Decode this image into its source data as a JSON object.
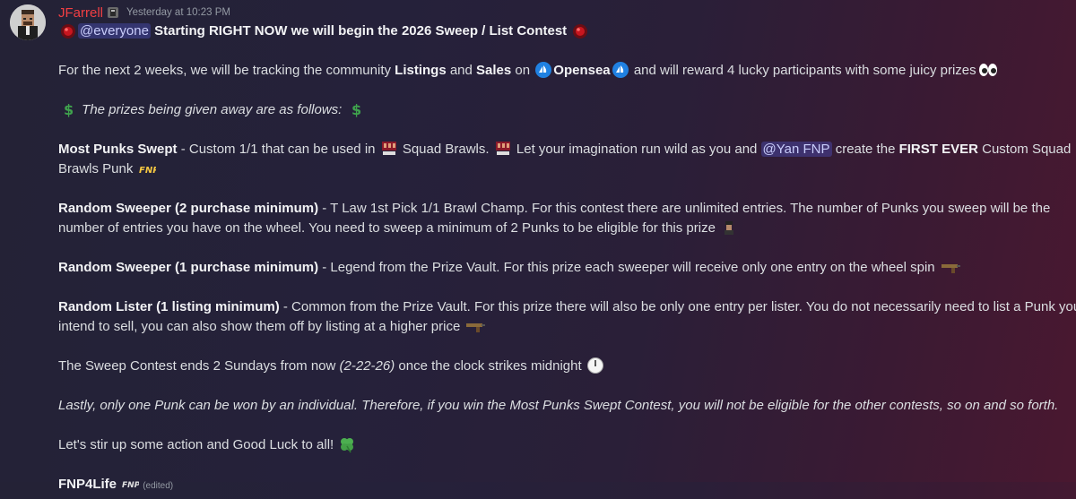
{
  "author": {
    "name": "JFarrell",
    "timestamp": "Yesterday at 10:23 PM"
  },
  "message": {
    "l1": {
      "mention": "@everyone",
      "text": "Starting RIGHT NOW we will begin the 2026 Sweep / List Contest"
    },
    "l2": {
      "t1": "For the next 2 weeks, we will be tracking the community ",
      "b1": "Listings",
      "t2": " and ",
      "b2": "Sales",
      "t3": " on ",
      "b3": "Opensea",
      "t4": " and will reward 4 lucky participants with some juicy prizes"
    },
    "l3": {
      "text": "The prizes being given away are as follows:"
    },
    "l4": {
      "b1": "Most Punks Swept",
      "t1": " - Custom 1/1 that can be used in ",
      "t2": " Squad Brawls. ",
      "t3": " Let your imagination run wild as you and ",
      "mention": "@Yan FNP",
      "t4": " create the ",
      "b2": "FIRST EVER",
      "t5": " Custom Squad",
      "t6": "Brawls Punk"
    },
    "l5": {
      "b1": "Random Sweeper (2 purchase minimum)",
      "t1": " - T Law 1st Pick 1/1 Brawl Champ. For this contest there are unlimited entries. The number of Punks you sweep  will be the",
      "t2": "number of entries you have on the wheel. You need to sweep a minimum of 2 Punks to be eligible for this prize"
    },
    "l6": {
      "b1": "Random Sweeper (1 purchase minimum)",
      "t1": " - Legend from the Prize Vault. For this prize each sweeper will receive only one entry on the wheel spin"
    },
    "l7": {
      "b1": "Random Lister (1 listing minimum)",
      "t1": " - Common from the Prize Vault. For this prize there will also be only one entry per lister. You do not necessarily need to list a Punk you",
      "t2": "intend to sell, you can also show them off by listing at a higher price"
    },
    "l8": {
      "t1": "The Sweep Contest ends 2 Sundays from now ",
      "i1": "(2-22-26)",
      "t2": " once the clock strikes midnight"
    },
    "l9": {
      "text": "Lastly, only one Punk can be won by an individual. Therefore, if you win the Most Punks Swept Contest, you will not be eligible for the other contests, so on and so forth."
    },
    "l10": {
      "text": "Let's stir up some action and Good Luck to all!"
    },
    "l11": {
      "b1": "FNP4Life",
      "edited": "(edited)"
    }
  },
  "icons": {
    "avatar": "pixel-punk-avatar",
    "role": "role-badge-icon",
    "siren": "red-siren-emoji",
    "opensea": "opensea-logo-emoji",
    "eyes": "eyes-emoji",
    "dollar": "dollar-sign-emoji",
    "squad": "squad-brawls-emoji",
    "fnp": "fnp-logo-emoji",
    "punk": "punk-emoji",
    "gun": "gun-emoji",
    "clock": "clock-emoji",
    "clover": "four-leaf-clover-emoji"
  },
  "colors": {
    "username": "#f23f43",
    "mention_bg": "#5865f2",
    "opensea": "#2081e2"
  }
}
